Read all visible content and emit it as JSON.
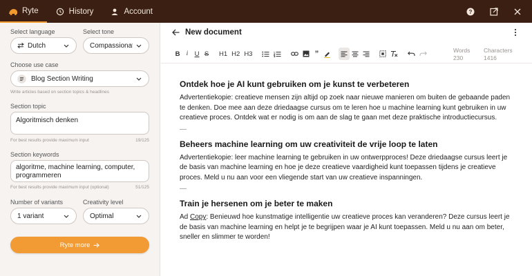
{
  "topbar": {
    "tabs": [
      {
        "label": "Ryte",
        "icon": "ryte-logo-icon",
        "active": true
      },
      {
        "label": "History",
        "icon": "history-icon",
        "active": false
      },
      {
        "label": "Account",
        "icon": "account-icon",
        "active": false
      }
    ],
    "actions": [
      "help-icon",
      "open-external-icon",
      "close-icon"
    ],
    "accent_color": "#f39a2e",
    "bg_color": "#3a1f12"
  },
  "sidebar": {
    "language": {
      "label": "Select language",
      "value": "Dutch"
    },
    "tone": {
      "label": "Select tone",
      "value": "Compassionate"
    },
    "use_case": {
      "label": "Choose use case",
      "value": "Blog Section Writing",
      "hint": "Write articles based on section topics & headlines"
    },
    "topic": {
      "label": "Section topic",
      "value": "Algoritmisch denken",
      "hint": "For best results provide maximum input",
      "count": "19/125"
    },
    "keywords": {
      "label": "Section keywords",
      "value": "algoritme, machine learning, computer, programmeren",
      "hint": "For best results provide maximum input (optional)",
      "count": "51/125"
    },
    "variants": {
      "label": "Number of variants",
      "value": "1 variant"
    },
    "creativity": {
      "label": "Creativity level",
      "value": "Optimal"
    },
    "cta": {
      "label": "Ryte more",
      "color": "#f29a34"
    }
  },
  "editor": {
    "title": "New document",
    "toolbar": {
      "headings": [
        "H1",
        "H2",
        "H3"
      ],
      "words_label": "Words",
      "words_value": "230",
      "chars_label": "Characters",
      "chars_value": "1416"
    },
    "sections": [
      {
        "heading": "Ontdek hoe je AI kunt gebruiken om je kunst te verbeteren",
        "body": "Advertentiekopie: creatieve mensen zijn altijd op zoek naar nieuwe manieren om buiten de gebaande paden te denken. Doe mee aan deze driedaagse cursus om te leren hoe u machine learning kunt gebruiken in uw creatieve proces. Ontdek wat er nodig is om aan de slag te gaan met deze praktische introductiecursus."
      },
      {
        "heading": "Beheers machine learning om uw creativiteit de vrije loop te laten",
        "body": "Advertentiekopie: leer machine learning te gebruiken in uw ontwerpproces! Deze driedaagse cursus leert je de basis van machine learning en hoe je deze creatieve vaardigheid kunt toepassen tijdens je creatieve proces. Meld u nu aan voor een vliegende start van uw creatieve inspanningen."
      },
      {
        "heading": "Train je hersenen om je beter te maken",
        "body_prefix": "Ad ",
        "body_underlined": "Copy",
        "body": ": Benieuwd hoe kunstmatige intelligentie uw creatieve proces kan veranderen? Deze cursus leert je de basis van machine learning en helpt je te begrijpen waar je AI kunt toepassen. Meld u nu aan om beter, sneller en slimmer te worden!"
      }
    ],
    "separator": "—"
  }
}
